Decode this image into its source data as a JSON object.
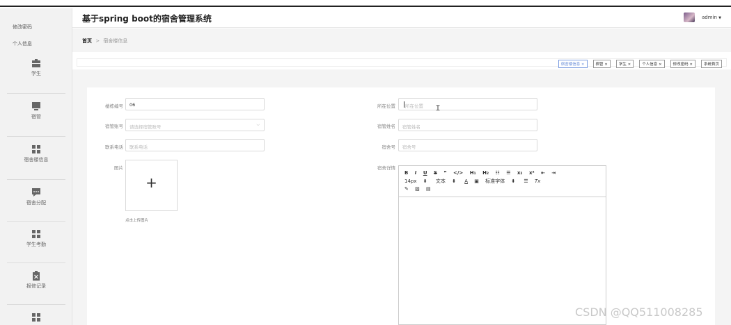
{
  "app": {
    "title": "基于spring boot的宿舍管理系统",
    "username": "admin",
    "user_caret": "▼"
  },
  "sidebar": {
    "links": [
      "修改密码",
      "个人信息"
    ],
    "items": [
      {
        "label": "学生",
        "icon": "briefcase-icon"
      },
      {
        "label": "宿管",
        "icon": "monitor-icon"
      },
      {
        "label": "宿舍楼信息",
        "icon": "grid-icon"
      },
      {
        "label": "宿舍分配",
        "icon": "chat-icon"
      },
      {
        "label": "学生考勤",
        "icon": "grid-icon"
      },
      {
        "label": "报修记录",
        "icon": "clipboard-x-icon"
      },
      {
        "label": "",
        "icon": "grid-icon"
      }
    ]
  },
  "breadcrumb": {
    "home": "首页",
    "separator": ">",
    "current": "宿舍楼信息"
  },
  "tabs": [
    {
      "label": "宿舍楼信息 ×",
      "active": true
    },
    {
      "label": "宿管 ×",
      "active": false
    },
    {
      "label": "学生 ×",
      "active": false
    },
    {
      "label": "个人信息 ×",
      "active": false
    },
    {
      "label": "修改密码 ×",
      "active": false
    },
    {
      "label": "系统首页",
      "active": false
    }
  ],
  "form": {
    "building_no": {
      "label": "楼栋编号",
      "value": "06"
    },
    "location": {
      "label": "所在位置",
      "placeholder": "所在位置"
    },
    "manager_account": {
      "label": "宿管账号",
      "placeholder": "请选择宿管账号"
    },
    "manager_name": {
      "label": "宿管姓名",
      "placeholder": "宿管姓名"
    },
    "phone": {
      "label": "联系电话",
      "placeholder": "联系电话"
    },
    "room_no": {
      "label": "宿舍号",
      "placeholder": "宿舍号"
    },
    "image": {
      "label": "图片",
      "plus": "+",
      "hint": "点击上传图片"
    },
    "details": {
      "label": "宿舍详情"
    }
  },
  "editor": {
    "row1": [
      "B",
      "I",
      "U",
      "S",
      "❞",
      "</>",
      "H₁",
      "H₂",
      "☷",
      "☰",
      "x₂",
      "x²",
      "⇤",
      "⇥"
    ],
    "row2": [
      "14px",
      "⬍",
      "文本",
      "⬍",
      "A",
      "▣",
      "标准字体",
      "⬍",
      "☰",
      "Tx"
    ],
    "row3": [
      "✎",
      "▨",
      "▤"
    ]
  },
  "watermark": "CSDN @QQ511008285",
  "colors": {
    "accent": "#6b8fd9",
    "sidebar_bg": "#f2f2f2",
    "bg": "#f4f4f4"
  }
}
